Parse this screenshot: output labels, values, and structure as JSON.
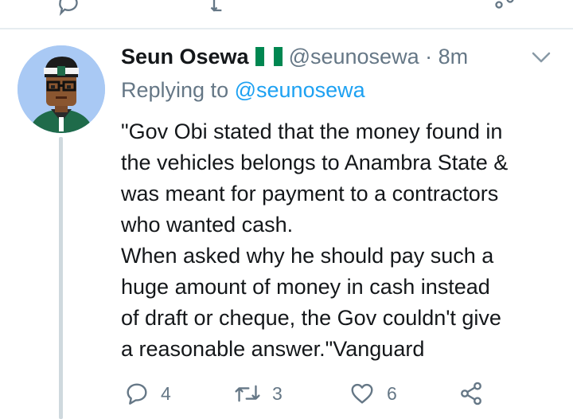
{
  "icons": {
    "avatar": "avatar-illustration",
    "flag": "nigeria-flag-icon",
    "more": "chevron-down-icon",
    "reply": "reply-icon",
    "retweet": "retweet-icon",
    "like": "heart-icon",
    "share": "share-icon"
  },
  "colors": {
    "text": "#14171a",
    "muted": "#657786",
    "link": "#1da1f2",
    "thread_line": "#cfd9de",
    "flag_green": "#008751"
  },
  "tweet": {
    "author_name": "Seun Osewa",
    "handle_and_time": "@seunosewa · 8m",
    "replying_prefix": "Replying to",
    "replying_handle": "@seunosewa",
    "text": "\"Gov Obi stated that the money found in\nthe vehicles belongs to Anambra State &\nwas meant for payment to a contractors\nwho wanted cash.\nWhen asked why he should pay such a\nhuge amount of money in cash instead\nof draft or cheque, the Gov couldn't give\na reasonable answer.\"Vanguard"
  },
  "actions": {
    "reply_count": "4",
    "retweet_count": "3",
    "like_count": "6"
  }
}
